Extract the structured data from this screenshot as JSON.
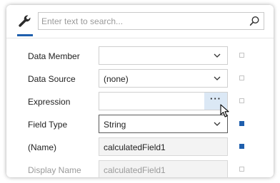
{
  "toolbar": {
    "wrench_icon": "wrench-icon",
    "search_placeholder": "Enter text to search...",
    "search_icon": "search-icon"
  },
  "rows": [
    {
      "label": "Data Member",
      "value": "",
      "editor": "dropdown",
      "marker": "empty"
    },
    {
      "label": "Data Source",
      "value": "(none)",
      "editor": "dropdown",
      "marker": "empty"
    },
    {
      "label": "Expression",
      "value": "",
      "editor": "ellipsis",
      "button_label": "···",
      "marker": "empty"
    },
    {
      "label": "Field Type",
      "value": "String",
      "editor": "dropdown",
      "marker": "filled"
    },
    {
      "label": "(Name)",
      "value": "calculatedField1",
      "editor": "text",
      "marker": "filled"
    },
    {
      "label": "Display Name",
      "value": "calculatedField1",
      "editor": "readonly",
      "marker": "empty"
    }
  ],
  "colors": {
    "accent": "#1f5fad",
    "ellipsis_hover": "#dbe8f5"
  }
}
